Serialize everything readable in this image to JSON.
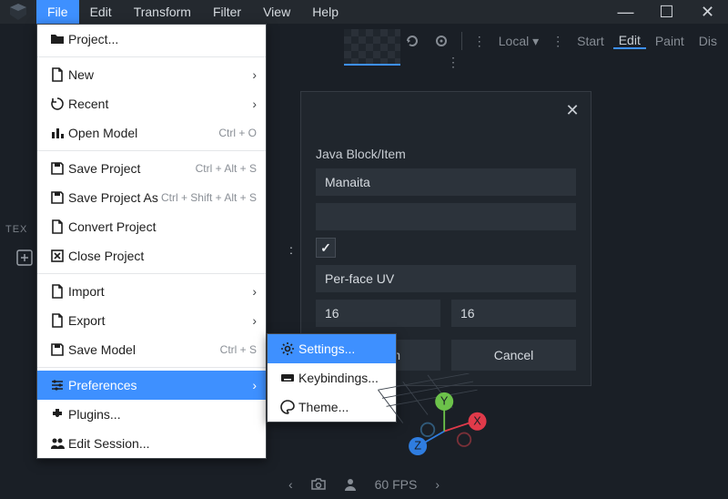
{
  "menubar": {
    "items": [
      "File",
      "Edit",
      "Transform",
      "Filter",
      "View",
      "Help"
    ]
  },
  "toolbar": {
    "space_label": "Local",
    "modes": [
      "Start",
      "Edit",
      "Paint",
      "Dis"
    ]
  },
  "textures_label": "TEX",
  "file_menu": {
    "items": [
      {
        "icon": "folder",
        "label": "Project...",
        "shortcut": "",
        "arrow": false
      },
      {
        "sep": true
      },
      {
        "icon": "file",
        "label": "New",
        "shortcut": "",
        "arrow": true
      },
      {
        "icon": "history",
        "label": "Recent",
        "shortcut": "",
        "arrow": true
      },
      {
        "icon": "chart",
        "label": "Open Model",
        "shortcut": "Ctrl + O",
        "arrow": false
      },
      {
        "sep": true
      },
      {
        "icon": "save",
        "label": "Save Project",
        "shortcut": "Ctrl + Alt + S",
        "arrow": false
      },
      {
        "icon": "save",
        "label": "Save Project As",
        "shortcut": "Ctrl + Shift + Alt + S",
        "arrow": false
      },
      {
        "icon": "file",
        "label": "Convert Project",
        "shortcut": "",
        "arrow": false
      },
      {
        "icon": "close-box",
        "label": "Close Project",
        "shortcut": "",
        "arrow": false
      },
      {
        "sep": true
      },
      {
        "icon": "file",
        "label": "Import",
        "shortcut": "",
        "arrow": true
      },
      {
        "icon": "file",
        "label": "Export",
        "shortcut": "",
        "arrow": true
      },
      {
        "icon": "save",
        "label": "Save Model",
        "shortcut": "Ctrl + S",
        "arrow": false
      },
      {
        "sep": true
      },
      {
        "icon": "sliders",
        "label": "Preferences",
        "shortcut": "",
        "arrow": true
      },
      {
        "icon": "plugin",
        "label": "Plugins...",
        "shortcut": "",
        "arrow": false
      },
      {
        "icon": "people",
        "label": "Edit Session...",
        "shortcut": "",
        "arrow": false
      }
    ]
  },
  "pref_submenu": {
    "items": [
      {
        "icon": "gear",
        "label": "Settings..."
      },
      {
        "icon": "keyboard",
        "label": "Keybindings..."
      },
      {
        "icon": "palette",
        "label": "Theme..."
      }
    ]
  },
  "dialog": {
    "title": "Java Block/Item",
    "name": "Manaita",
    "filename": "",
    "colon_label": ":",
    "box_uv_checked": true,
    "uv_mode": "Per-face UV",
    "tex_w": "16",
    "tex_h": "16",
    "confirm": "Confirm",
    "cancel": "Cancel"
  },
  "bottombar": {
    "fps": "60 FPS"
  },
  "gizmo": {
    "x": "X",
    "y": "Y",
    "z": "Z"
  }
}
